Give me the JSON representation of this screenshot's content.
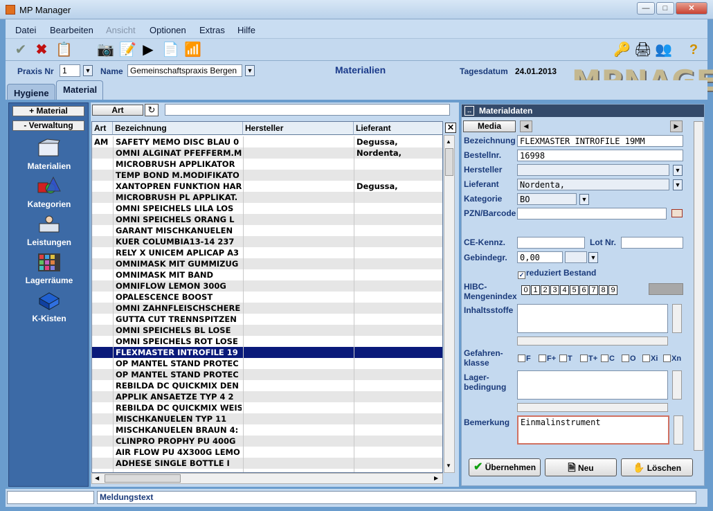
{
  "window": {
    "title": "MP Manager"
  },
  "menu": [
    "Datei",
    "Bearbeiten",
    "Ansicht",
    "Optionen",
    "Extras",
    "Hilfe"
  ],
  "menu_disabled": "Ansicht",
  "header": {
    "praxis_label": "Praxis Nr",
    "praxis_value": "1",
    "name_label": "Name",
    "name_value": "Gemeinschaftspraxis Bergen",
    "section_title": "Materialien",
    "date_label": "Tagesdatum",
    "date_value": "24.01.2013",
    "logo_text": "MPNAGER"
  },
  "tabs": [
    "Hygiene",
    "Material"
  ],
  "sidebar": {
    "btn_material": "+  Material",
    "btn_verwaltung": "-  Verwaltung",
    "items": [
      "Materialien",
      "Kategorien",
      "Leistungen",
      "Lagerräume",
      "K-Kisten"
    ]
  },
  "list": {
    "art_button": "Art",
    "search_value": "",
    "columns": [
      "Art",
      "Bezeichnung",
      "Hersteller",
      "Lieferant"
    ],
    "rows": [
      [
        "AM",
        "SAFETY MEMO DISC BLAU 0",
        "",
        "Degussa,"
      ],
      [
        "",
        "OMNI ALGINAT PFEFFERM.M",
        "",
        "Nordenta,"
      ],
      [
        "",
        "MICROBRUSH APPLIKATOR",
        "",
        ""
      ],
      [
        "",
        "TEMP BOND M.MODIFIKATO",
        "",
        ""
      ],
      [
        "",
        "XANTOPREN FUNKTION HAR",
        "",
        "Degussa,"
      ],
      [
        "",
        "MICROBRUSH PL APPLIKAT.",
        "",
        ""
      ],
      [
        "",
        "OMNI SPEICHELS LILA LOS",
        "",
        ""
      ],
      [
        "",
        "OMNI SPEICHELS ORANG L",
        "",
        ""
      ],
      [
        "",
        "GARANT MISCHKANUELEN",
        "",
        ""
      ],
      [
        "",
        "KUER COLUMBIA13-14  237",
        "",
        ""
      ],
      [
        "",
        "RELY X UNICEM APLICAP A3",
        "",
        ""
      ],
      [
        "",
        "OMNIMASK MIT GUMMIZUG",
        "",
        ""
      ],
      [
        "",
        "OMNIMASK MIT BAND",
        "",
        ""
      ],
      [
        "",
        "OMNIFLOW LEMON 300G",
        "",
        ""
      ],
      [
        "",
        "OPALESCENCE BOOST",
        "",
        ""
      ],
      [
        "",
        "OMNI ZAHNFLEISCHSCHERE",
        "",
        ""
      ],
      [
        "",
        "GUTTA CUT TRENNSPITZEN",
        "",
        ""
      ],
      [
        "",
        "OMNI SPEICHELS BL LOSE",
        "",
        ""
      ],
      [
        "",
        "OMNI SPEICHELS ROT LOSE",
        "",
        ""
      ],
      [
        "",
        "FLEXMASTER INTROFILE 19",
        "",
        ""
      ],
      [
        "",
        "OP MANTEL STAND PROTEC",
        "",
        ""
      ],
      [
        "",
        "OP MANTEL STAND PROTEC",
        "",
        ""
      ],
      [
        "",
        "REBILDA DC QUICKMIX DEN",
        "",
        ""
      ],
      [
        "",
        "APPLIK ANSAETZE TYP 4    2",
        "",
        ""
      ],
      [
        "",
        "REBILDA DC QUICKMIX WEIS",
        "",
        ""
      ],
      [
        "",
        "MISCHKANUELEN TYP 11",
        "",
        ""
      ],
      [
        "",
        "MISCHKANUELEN BRAUN 4:",
        "",
        ""
      ],
      [
        "",
        "CLINPRO PROPHY PU 400G",
        "",
        ""
      ],
      [
        "",
        "AIR FLOW PU 4X300G LEMO",
        "",
        ""
      ],
      [
        "",
        "ADHESE SINGLE BOTTLE   I",
        "",
        ""
      ]
    ],
    "selected_index": 19
  },
  "details": {
    "title": "Materialdaten",
    "media_button": "Media",
    "labels": {
      "bezeichnung": "Bezeichnung",
      "bestellnr": "Bestellnr.",
      "hersteller": "Hersteller",
      "lieferant": "Lieferant",
      "kategorie": "Kategorie",
      "pzn": "PZN/Barcode",
      "ce": "CE-Kennz.",
      "lot": "Lot Nr.",
      "gebinde": "Gebindegr.",
      "reduziert": "reduziert Bestand",
      "hibc1": "HIBC-",
      "hibc2": "Mengenindex",
      "inhalt": "Inhaltsstoffe",
      "gefahr1": "Gefahren-",
      "gefahr2": "klasse",
      "lager1": "Lager-",
      "lager2": "bedingung",
      "bemerkung": "Bemerkung"
    },
    "values": {
      "bezeichnung": "FLEXMASTER INTROFILE 19MM",
      "bestellnr": "16998",
      "hersteller": "",
      "lieferant": "Nordenta,",
      "kategorie": "BO",
      "pzn": "",
      "ce": "",
      "lot": "",
      "gebinde": "0,00",
      "bemerkung": "Einmalinstrument"
    },
    "hibc_digits": [
      "0",
      "1",
      "2",
      "3",
      "4",
      "5",
      "6",
      "7",
      "8",
      "9"
    ],
    "hazard_classes": [
      "F",
      "F+",
      "T",
      "T+",
      "C",
      "O",
      "Xi",
      "Xn"
    ],
    "buttons": {
      "save": "Übernehmen",
      "new": "Neu",
      "delete": "Löschen"
    }
  },
  "status": {
    "left": "",
    "message": "Meldungstext"
  }
}
